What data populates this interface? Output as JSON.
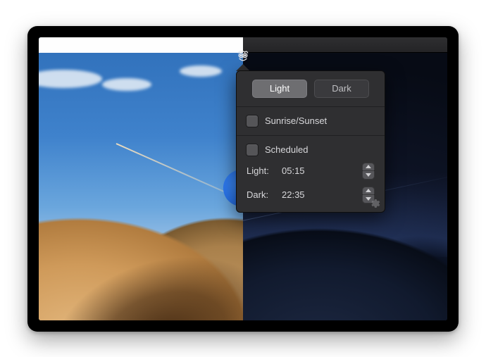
{
  "segmented": {
    "light": "Light",
    "dark": "Dark",
    "active": "light"
  },
  "options": {
    "sunrise_sunset_label": "Sunrise/Sunset",
    "scheduled_label": "Scheduled"
  },
  "schedule": {
    "light_label": "Light:",
    "light_time": "05:15",
    "dark_label": "Dark:",
    "dark_time": "22:35"
  }
}
